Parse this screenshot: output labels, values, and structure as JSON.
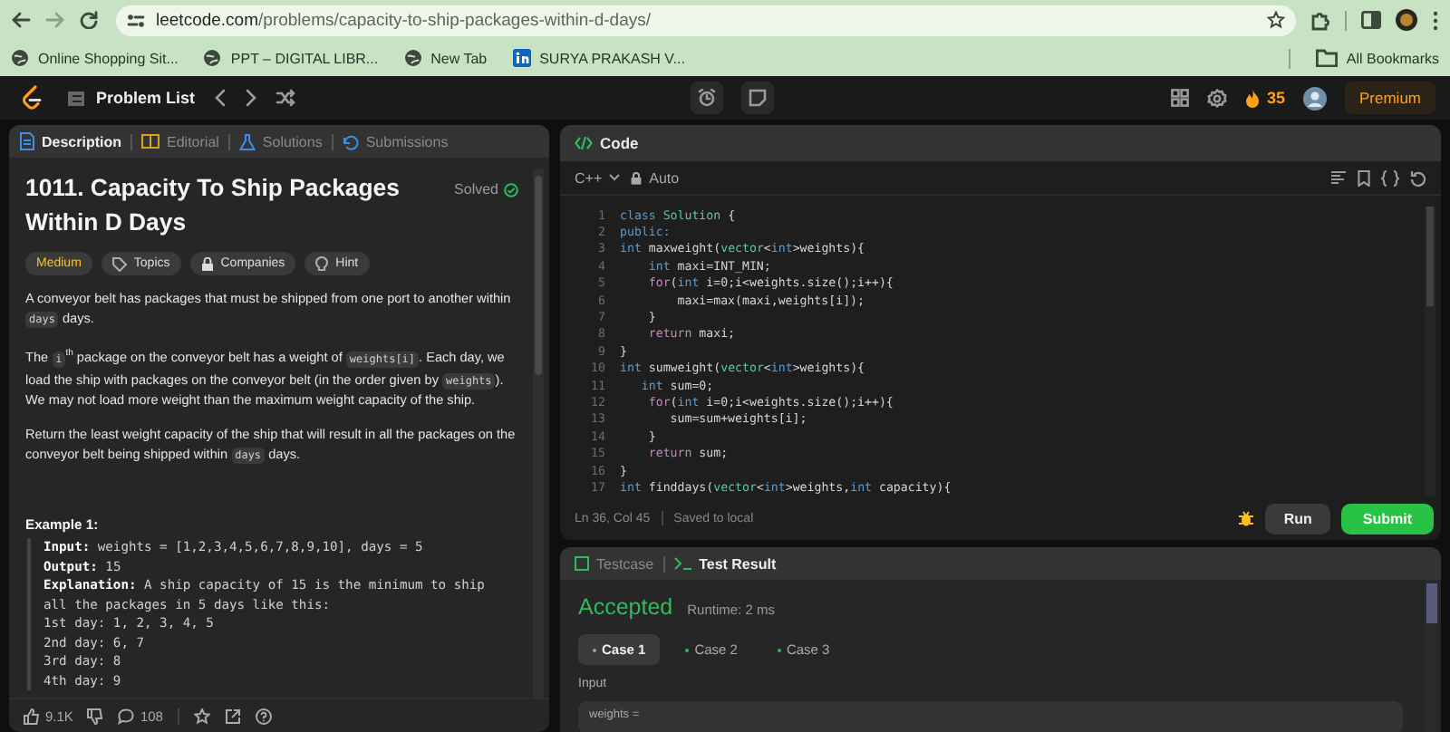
{
  "browser": {
    "url_domain": "leetcode.com",
    "url_path": "/problems/capacity-to-ship-packages-within-d-days/",
    "bookmarks": [
      {
        "label": "Online Shopping Sit...",
        "kind": "globe"
      },
      {
        "label": "PPT – DIGITAL LIBR...",
        "kind": "globe"
      },
      {
        "label": "New Tab",
        "kind": "globe"
      },
      {
        "label": "SURYA PRAKASH V...",
        "kind": "linkedin"
      }
    ],
    "all_bookmarks": "All Bookmarks"
  },
  "nav": {
    "problem_list": "Problem List",
    "streak": "35",
    "premium": "Premium"
  },
  "description": {
    "tabs": [
      {
        "label": "Description",
        "selected": true
      },
      {
        "label": "Editorial",
        "selected": false
      },
      {
        "label": "Solutions",
        "selected": false
      },
      {
        "label": "Submissions",
        "selected": false
      }
    ],
    "title": "1011. Capacity To Ship Packages Within D Days",
    "status": "Solved",
    "difficulty": "Medium",
    "tags": [
      {
        "label": "Topics",
        "kind": "tag"
      },
      {
        "label": "Companies",
        "kind": "lock"
      },
      {
        "label": "Hint",
        "kind": "bulb"
      }
    ],
    "paragraphs": [
      [
        {
          "t": "A conveyor belt has packages that must be shipped from one port to another within ",
          "kind": "text"
        },
        {
          "t": "days",
          "kind": "code"
        },
        {
          "t": " days.",
          "kind": "text"
        }
      ],
      [
        {
          "t": "The ",
          "kind": "text"
        },
        {
          "t": "i",
          "kind": "code"
        },
        {
          "t": "th",
          "kind": "sup"
        },
        {
          "t": " package on the conveyor belt has a weight of ",
          "kind": "text"
        },
        {
          "t": "weights[i]",
          "kind": "code"
        },
        {
          "t": ". Each day, we load the ship with packages on the conveyor belt (in the order given by ",
          "kind": "text"
        },
        {
          "t": "weights",
          "kind": "code"
        },
        {
          "t": "). We may not load more weight than the maximum weight capacity of the ship.",
          "kind": "text"
        }
      ],
      [
        {
          "t": "Return the least weight capacity of the ship that will result in all the packages on the conveyor belt being shipped within ",
          "kind": "text"
        },
        {
          "t": "days",
          "kind": "code"
        },
        {
          "t": " days.",
          "kind": "text"
        }
      ]
    ],
    "example_title": "Example 1:",
    "example_lines": [
      "**Input:** weights = [1,2,3,4,5,6,7,8,9,10], days = 5",
      "**Output:** 15",
      "**Explanation:** A ship capacity of 15 is the minimum to ship",
      "all the packages in 5 days like this:",
      "1st day: 1, 2, 3, 4, 5",
      "2nd day: 6, 7",
      "3rd day: 8",
      "4th day: 9"
    ],
    "likes": "9.1K",
    "comments": "108"
  },
  "code": {
    "title": "Code",
    "language": "C++",
    "mode": "Auto",
    "lines": [
      {
        "num": "1",
        "tokens": [
          {
            "t": "class",
            "kind": "kw"
          },
          {
            "t": " Solution",
            "kind": "type"
          },
          {
            "t": " {",
            "kind": "text"
          }
        ]
      },
      {
        "num": "2",
        "tokens": [
          {
            "t": "public:",
            "kind": "kw"
          }
        ]
      },
      {
        "num": "3",
        "tokens": [
          {
            "t": "int",
            "kind": "kw"
          },
          {
            "t": " maxweight(",
            "kind": "text"
          },
          {
            "t": "vector",
            "kind": "type"
          },
          {
            "t": "<",
            "kind": "text"
          },
          {
            "t": "int",
            "kind": "kw"
          },
          {
            "t": ">weights){",
            "kind": "text"
          }
        ]
      },
      {
        "num": "4",
        "tokens": [
          {
            "t": "    int",
            "kind": "kw"
          },
          {
            "t": " maxi=INT_MIN;",
            "kind": "text"
          }
        ]
      },
      {
        "num": "5",
        "tokens": [
          {
            "t": "    for",
            "kind": "ctl"
          },
          {
            "t": "(",
            "kind": "text"
          },
          {
            "t": "int",
            "kind": "kw"
          },
          {
            "t": " i=0;i<weights.size();i++){",
            "kind": "text"
          }
        ]
      },
      {
        "num": "6",
        "tokens": [
          {
            "t": "        maxi=max(maxi,weights[i]);",
            "kind": "text"
          }
        ]
      },
      {
        "num": "7",
        "tokens": [
          {
            "t": "    }",
            "kind": "text"
          }
        ]
      },
      {
        "num": "8",
        "tokens": [
          {
            "t": "    return",
            "kind": "ctl"
          },
          {
            "t": " maxi;",
            "kind": "text"
          }
        ]
      },
      {
        "num": "9",
        "tokens": [
          {
            "t": "}",
            "kind": "text"
          }
        ]
      },
      {
        "num": "10",
        "tokens": [
          {
            "t": "int",
            "kind": "kw"
          },
          {
            "t": " sumweight(",
            "kind": "text"
          },
          {
            "t": "vector",
            "kind": "type"
          },
          {
            "t": "<",
            "kind": "text"
          },
          {
            "t": "int",
            "kind": "kw"
          },
          {
            "t": ">weights){",
            "kind": "text"
          }
        ]
      },
      {
        "num": "11",
        "tokens": [
          {
            "t": "   int",
            "kind": "kw"
          },
          {
            "t": " sum=0;",
            "kind": "text"
          }
        ]
      },
      {
        "num": "12",
        "tokens": [
          {
            "t": "    for",
            "kind": "ctl"
          },
          {
            "t": "(",
            "kind": "text"
          },
          {
            "t": "int",
            "kind": "kw"
          },
          {
            "t": " i=0;i<weights.size();i++){",
            "kind": "text"
          }
        ]
      },
      {
        "num": "13",
        "tokens": [
          {
            "t": "       sum=sum+weights[i];",
            "kind": "text"
          }
        ]
      },
      {
        "num": "14",
        "tokens": [
          {
            "t": "    }",
            "kind": "text"
          }
        ]
      },
      {
        "num": "15",
        "tokens": [
          {
            "t": "    return",
            "kind": "ctl"
          },
          {
            "t": " sum;",
            "kind": "text"
          }
        ]
      },
      {
        "num": "16",
        "tokens": [
          {
            "t": "}",
            "kind": "text"
          }
        ]
      },
      {
        "num": "17",
        "tokens": [
          {
            "t": "int",
            "kind": "kw"
          },
          {
            "t": " finddays(",
            "kind": "text"
          },
          {
            "t": "vector",
            "kind": "type"
          },
          {
            "t": "<",
            "kind": "text"
          },
          {
            "t": "int",
            "kind": "kw"
          },
          {
            "t": ">weights,",
            "kind": "text"
          },
          {
            "t": "int",
            "kind": "kw"
          },
          {
            "t": " capacity){",
            "kind": "text"
          }
        ]
      }
    ],
    "cursor": "Ln 36, Col 45",
    "save_status": "Saved to local",
    "run": "Run",
    "submit": "Submit"
  },
  "result": {
    "tabs": [
      {
        "label": "Testcase",
        "selected": false
      },
      {
        "label": "Test Result",
        "selected": true
      }
    ],
    "verdict": "Accepted",
    "runtime": "Runtime: 2 ms",
    "cases": [
      {
        "label": "Case 1",
        "selected": true
      },
      {
        "label": "Case 2",
        "selected": false
      },
      {
        "label": "Case 3",
        "selected": false
      }
    ],
    "input_label": "Input",
    "input_value": "weights ="
  }
}
